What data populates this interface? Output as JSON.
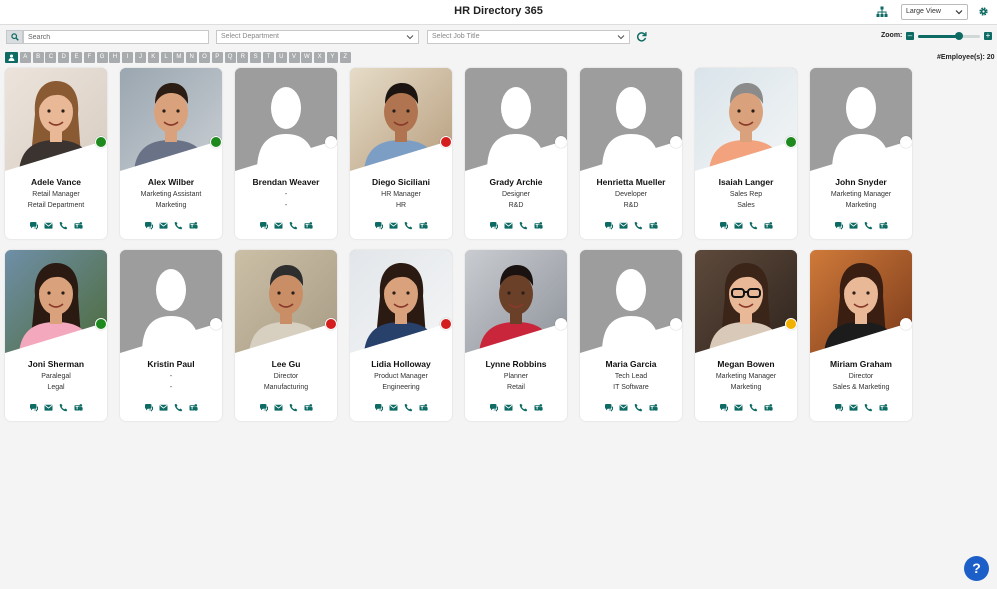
{
  "app": {
    "title": "HR Directory 365"
  },
  "header": {
    "view_selected": "Large View"
  },
  "filters": {
    "search_placeholder": "Search",
    "department_placeholder": "Select Department",
    "job_title_placeholder": "Select Job Title"
  },
  "zoom": {
    "label": "Zoom:",
    "level": 0.66
  },
  "alphabet": [
    "A",
    "B",
    "C",
    "D",
    "E",
    "F",
    "G",
    "H",
    "I",
    "J",
    "K",
    "L",
    "M",
    "N",
    "O",
    "P",
    "Q",
    "R",
    "S",
    "T",
    "U",
    "V",
    "W",
    "X",
    "Y",
    "Z"
  ],
  "employee_count": "#Employee(s): 20",
  "help_label": "?",
  "status_colors": {
    "available": "#1e8a1e",
    "busy": "#d41e1e",
    "away": "#f2b000",
    "offline": "#ffffff"
  },
  "employees": [
    {
      "name": "Adele Vance",
      "title": "Retail Manager",
      "department": "Retail Department",
      "status": "available",
      "photo": "person-light-hair"
    },
    {
      "name": "Alex Wilber",
      "title": "Marketing Assistant",
      "department": "Marketing",
      "status": "available",
      "photo": "person-office"
    },
    {
      "name": "Brendan Weaver",
      "title": "-",
      "department": "-",
      "status": "offline",
      "photo": "placeholder"
    },
    {
      "name": "Diego Siciliani",
      "title": "HR Manager",
      "department": "HR",
      "status": "busy",
      "photo": "person-bookshelf"
    },
    {
      "name": "Grady Archie",
      "title": "Designer",
      "department": "R&D",
      "status": "offline",
      "photo": "placeholder"
    },
    {
      "name": "Henrietta Mueller",
      "title": "Developer",
      "department": "R&D",
      "status": "offline",
      "photo": "placeholder"
    },
    {
      "name": "Isaiah Langer",
      "title": "Sales Rep",
      "department": "Sales",
      "status": "available",
      "photo": "person-window"
    },
    {
      "name": "John Snyder",
      "title": "Marketing Manager",
      "department": "Marketing",
      "status": "offline",
      "photo": "placeholder"
    },
    {
      "name": "Joni Sherman",
      "title": "Paralegal",
      "department": "Legal",
      "status": "available",
      "photo": "person-outdoor"
    },
    {
      "name": "Kristin Paul",
      "title": "-",
      "department": "-",
      "status": "offline",
      "photo": "placeholder"
    },
    {
      "name": "Lee Gu",
      "title": "Director",
      "department": "Manufacturing",
      "status": "busy",
      "photo": "person-desk"
    },
    {
      "name": "Lidia Holloway",
      "title": "Product Manager",
      "department": "Engineering",
      "status": "busy",
      "photo": "person-dark-hair"
    },
    {
      "name": "Lynne Robbins",
      "title": "Planner",
      "department": "Retail",
      "status": "offline",
      "photo": "person-street"
    },
    {
      "name": "Maria Garcia",
      "title": "Tech Lead",
      "department": "IT Software",
      "status": "offline",
      "photo": "placeholder"
    },
    {
      "name": "Megan Bowen",
      "title": "Marketing Manager",
      "department": "Marketing",
      "status": "away",
      "photo": "person-glasses"
    },
    {
      "name": "Miriam Graham",
      "title": "Director",
      "department": "Sales & Marketing",
      "status": "offline",
      "photo": "person-bangs"
    }
  ],
  "icons": {
    "org_chart": "org-chart-icon",
    "settings": "gear-icon",
    "search": "search-icon",
    "refresh": "refresh-icon",
    "chat": "chat-icon",
    "email": "mail-icon",
    "phone": "phone-icon",
    "teams": "teams-icon",
    "all_filter": "person-icon"
  }
}
